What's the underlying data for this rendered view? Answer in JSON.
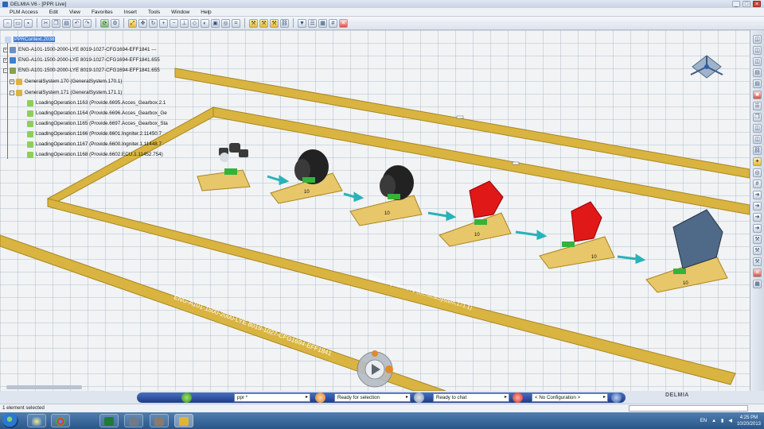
{
  "window": {
    "title": "DELMIA V6 - [PPR Live]",
    "controls": [
      "_",
      "□",
      "×"
    ]
  },
  "menu": [
    "PLM Access",
    "Edit",
    "View",
    "Favorites",
    "Insert",
    "Tools",
    "Window",
    "Help"
  ],
  "tree": {
    "root": "PPRContext.2038",
    "items": [
      "ENG-A101-1500-2000-LYE 8019-1027-CFG1694-EFF1841 ---",
      "ENG-A101-1500-2000-LYE 8019-1027-CFG1694-EFF1841.655",
      "ENG-A101-1500-2000-LYE 8019-1027-CFG1694-EFF1841.655",
      "GeneralSystem.170 (GeneralSystem.170.1)",
      "GeneralSystem.171 (GeneralSystem.171.1)",
      "LoadingOperation.1163 (Provide.6695.Acces_Gearbox.2.1",
      "LoadingOperation.1164 (Provide.6696.Acces_Gearbox_Ge",
      "LoadingOperation.1165 (Provide.6697.Acces_Gearbox_Sta",
      "LoadingOperation.1166 (Provide.6601.Ingniter.2.11450.7",
      "LoadingOperation.1167 (Provide.6600.Ingniter.1.11448.7",
      "LoadingOperation.1168 (Provide.6602.ECU.1.11452.754)"
    ]
  },
  "scene": {
    "system_label": "GeneralSystem.171 (GeneralSystem.171.1)",
    "eng_label": "ENG-A101-1500-2000-LYE 8019-1027-CFG1694-EFF1841",
    "station_counts": [
      "10",
      "10",
      "10",
      "10",
      "10"
    ]
  },
  "commandbar": {
    "context": "ppr *",
    "status1": "Ready for selection",
    "status2": "Ready to chat",
    "config": "< No Configuration >",
    "brand": "DELMIA"
  },
  "statusbar": {
    "message": "1 element selected"
  },
  "taskbar": {
    "lang": "EN",
    "time": "4:25 PM",
    "date": "10/20/2013"
  },
  "colors": {
    "rail": "#d9b440",
    "rail_edge": "#a8861f",
    "station_pad": "#e8c66a",
    "flow_arrow": "#27b3b8",
    "part_red": "#e01818",
    "part_dark": "#2a2a2a",
    "part_steel": "#4f6a88",
    "selection": "#3d7bd8"
  },
  "icons": [
    "start-orb-icon",
    "ie-icon",
    "chrome-icon",
    "excel-icon",
    "delmia-icon",
    "compass-icon",
    "play-icon"
  ]
}
